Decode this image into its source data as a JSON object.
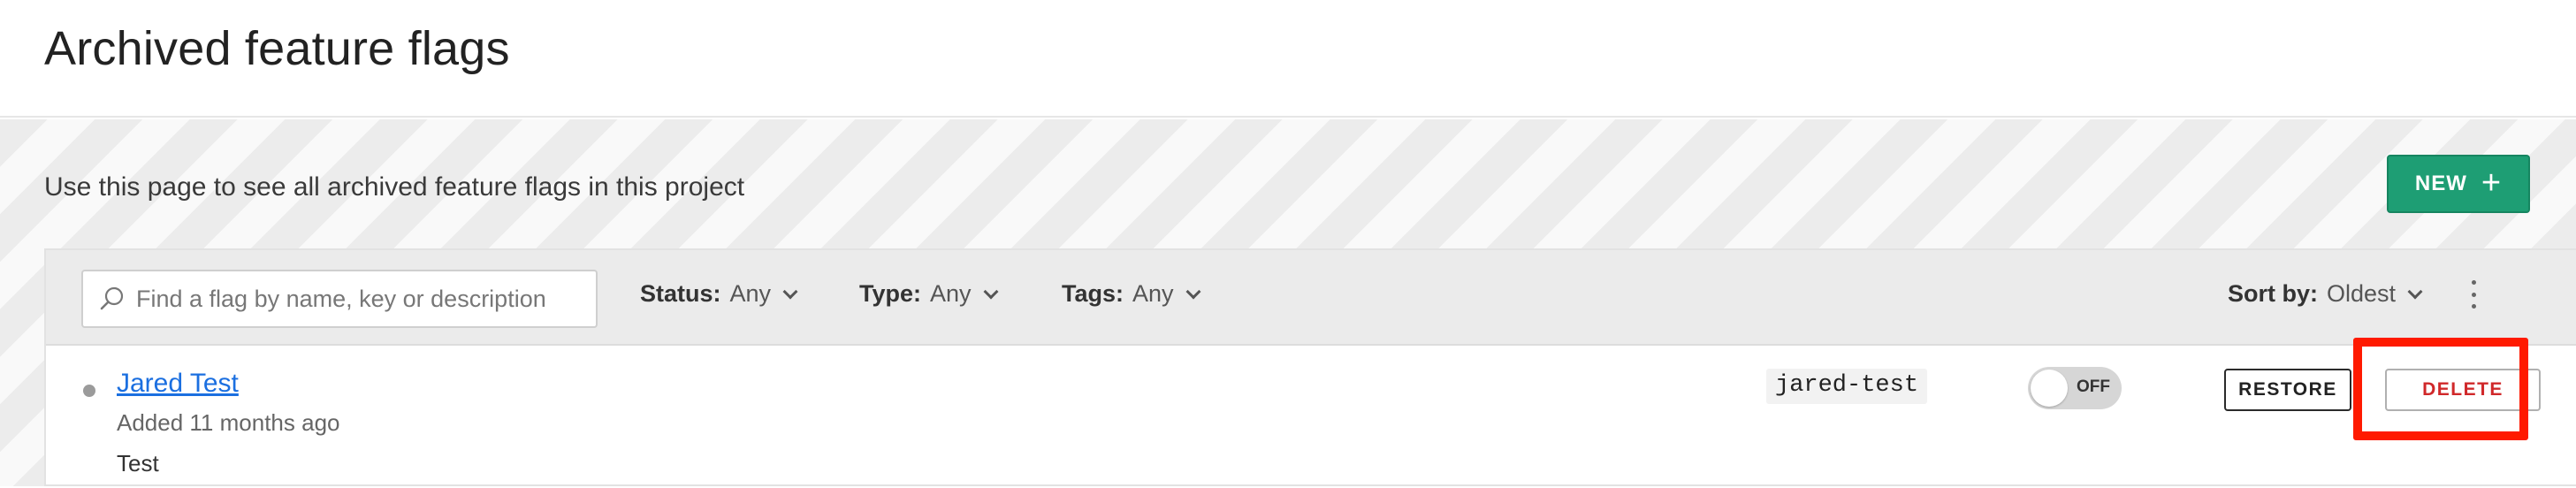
{
  "header": {
    "title": "Archived feature flags"
  },
  "main": {
    "description": "Use this page to see all archived feature flags in this project",
    "new_button": {
      "label": "NEW",
      "icon": "plus-icon"
    }
  },
  "filters": {
    "search": {
      "placeholder": "Find a flag by name, key or description",
      "value": ""
    },
    "status": {
      "label": "Status:",
      "value": "Any"
    },
    "type": {
      "label": "Type:",
      "value": "Any"
    },
    "tags": {
      "label": "Tags:",
      "value": "Any"
    },
    "sort": {
      "label": "Sort by:",
      "value": "Oldest"
    },
    "more_icon": "kebab-menu-icon"
  },
  "flags": [
    {
      "name": "Jared Test",
      "added": "Added 11 months ago",
      "description": "Test",
      "key": "jared-test",
      "toggle_state": "OFF",
      "restore_label": "RESTORE",
      "delete_label": "DELETE"
    }
  ],
  "colors": {
    "accent_green": "#1e9e74",
    "link_blue": "#1b6fe0",
    "danger_red": "#d0282a",
    "highlight_red": "#ff1a00"
  }
}
